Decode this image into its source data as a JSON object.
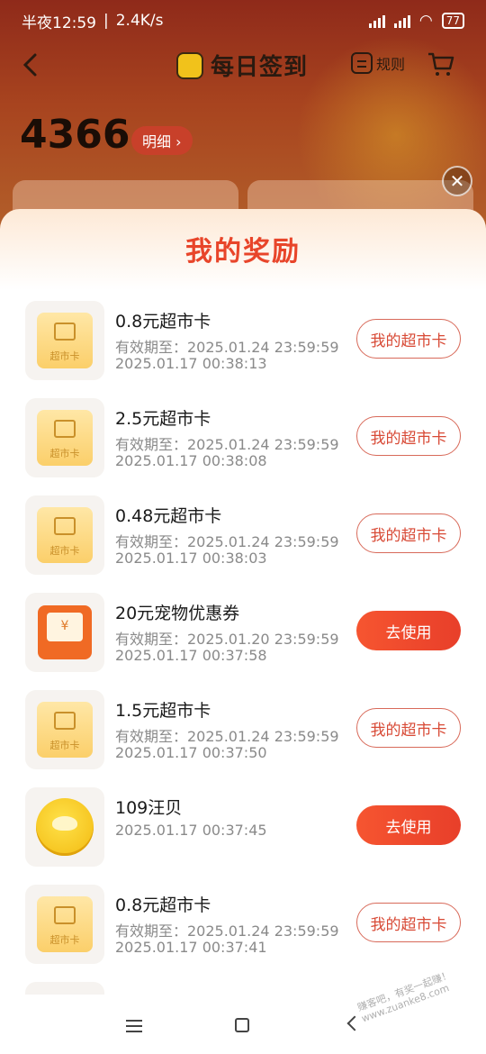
{
  "status_bar": {
    "time": "半夜12:59",
    "speed": "2.4K/s",
    "battery": "77"
  },
  "header": {
    "title": "每日签到",
    "rule_label": "规则",
    "points": "4366",
    "detail_label": "明细 ›"
  },
  "sheet": {
    "title": "我的奖励",
    "close_label": "✕"
  },
  "rewards": [
    {
      "icon": "supermarket-card-icon",
      "icon_text": "超市卡",
      "title": "0.8元超市卡",
      "line1": "有效期至：2025.01.24 23:59:59",
      "line2": "2025.01.17 00:38:13",
      "button": "我的超市卡",
      "button_style": "outline"
    },
    {
      "icon": "supermarket-card-icon",
      "icon_text": "超市卡",
      "title": "2.5元超市卡",
      "line1": "有效期至：2025.01.24 23:59:59",
      "line2": "2025.01.17 00:38:08",
      "button": "我的超市卡",
      "button_style": "outline"
    },
    {
      "icon": "supermarket-card-icon",
      "icon_text": "超市卡",
      "title": "0.48元超市卡",
      "line1": "有效期至：2025.01.24 23:59:59",
      "line2": "2025.01.17 00:38:03",
      "button": "我的超市卡",
      "button_style": "outline"
    },
    {
      "icon": "pet-coupon-icon",
      "icon_text": "¥",
      "title": "20元宠物优惠券",
      "line1": "有效期至：2025.01.20 23:59:59",
      "line2": "2025.01.17 00:37:58",
      "button": "去使用",
      "button_style": "filled"
    },
    {
      "icon": "supermarket-card-icon",
      "icon_text": "超市卡",
      "title": "1.5元超市卡",
      "line1": "有效期至：2025.01.24 23:59:59",
      "line2": "2025.01.17 00:37:50",
      "button": "我的超市卡",
      "button_style": "outline"
    },
    {
      "icon": "coin-icon",
      "icon_text": "",
      "title": "109汪贝",
      "line1": "2025.01.17 00:37:45",
      "line2": "",
      "button": "去使用",
      "button_style": "filled"
    },
    {
      "icon": "supermarket-card-icon",
      "icon_text": "超市卡",
      "title": "0.8元超市卡",
      "line1": "有效期至：2025.01.24 23:59:59",
      "line2": "2025.01.17 00:37:41",
      "button": "我的超市卡",
      "button_style": "outline"
    }
  ],
  "watermark": "赚客吧，有奖一起赚！www.zuanke8.com"
}
